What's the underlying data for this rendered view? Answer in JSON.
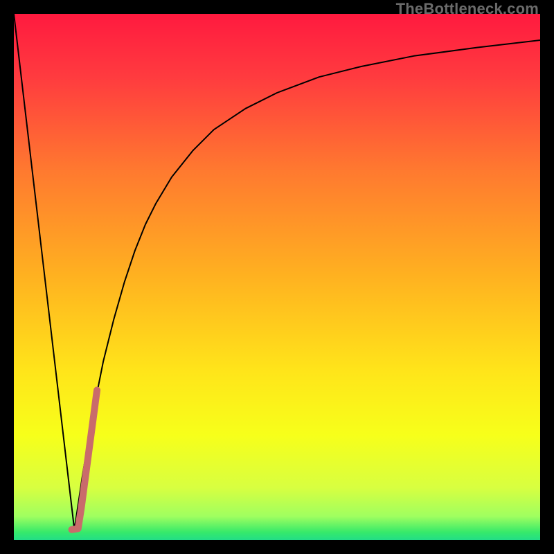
{
  "watermark": "TheBottleneck.com",
  "chart_data": {
    "type": "line",
    "title": "",
    "xlabel": "",
    "ylabel": "",
    "xlim": [
      0,
      100
    ],
    "ylim": [
      0,
      100
    ],
    "grid": false,
    "gradient_stops": [
      {
        "offset": 0.0,
        "color": "#ff1a3f"
      },
      {
        "offset": 0.12,
        "color": "#ff3b3f"
      },
      {
        "offset": 0.3,
        "color": "#ff7a2f"
      },
      {
        "offset": 0.5,
        "color": "#ffb220"
      },
      {
        "offset": 0.68,
        "color": "#ffe51a"
      },
      {
        "offset": 0.8,
        "color": "#f7ff1a"
      },
      {
        "offset": 0.9,
        "color": "#d8ff40"
      },
      {
        "offset": 0.955,
        "color": "#9fff60"
      },
      {
        "offset": 0.985,
        "color": "#36e96a"
      },
      {
        "offset": 1.0,
        "color": "#22dd88"
      }
    ],
    "series": [
      {
        "name": "left-descending",
        "color": "#000000",
        "width": 2.0,
        "x": [
          0,
          11.5
        ],
        "y": [
          100,
          2
        ]
      },
      {
        "name": "right-curve",
        "color": "#000000",
        "width": 2.0,
        "x": [
          11.5,
          13,
          15,
          17,
          19,
          21,
          23,
          25,
          27,
          30,
          34,
          38,
          44,
          50,
          58,
          66,
          76,
          88,
          100
        ],
        "y": [
          2,
          12,
          24,
          34,
          42,
          49,
          55,
          60,
          64,
          69,
          74,
          78,
          82,
          85,
          88,
          90,
          92,
          93.6,
          95
        ]
      },
      {
        "name": "highlight",
        "color": "#c96b6b",
        "width": 10,
        "linecap": "round",
        "x": [
          11.0,
          12.2,
          12.8,
          13.6,
          14.4,
          15.2,
          15.8
        ],
        "y": [
          2.0,
          2.2,
          6.0,
          12.0,
          18.0,
          24.0,
          28.5
        ]
      }
    ]
  }
}
